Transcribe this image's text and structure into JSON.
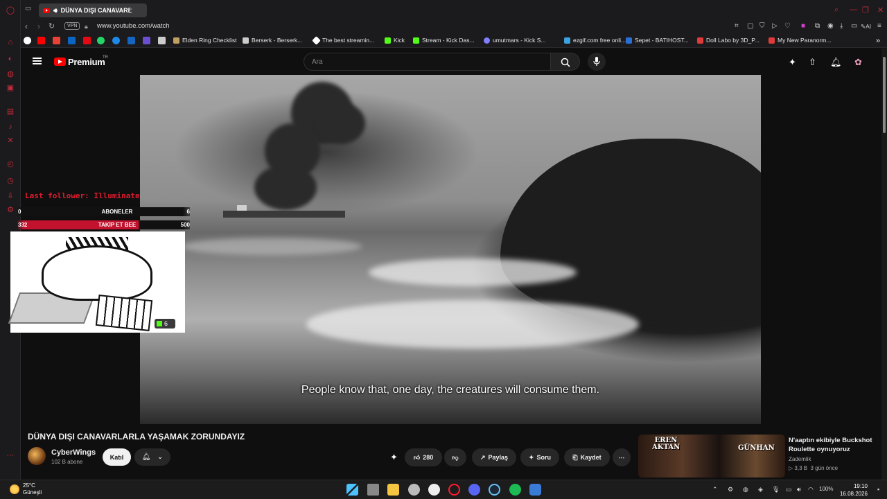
{
  "browser": {
    "tab_title": "DÜNYA DIŞI CANAVARL",
    "url": "www.youtube.com/watch",
    "vpn_label": "VPN",
    "ai_label": "AI",
    "bookmarks": [
      {
        "label": "Elden Ring Checklist",
        "color": "#c0a060"
      },
      {
        "label": "Berserk - Berserk...",
        "color": "#cccccc"
      },
      {
        "label": "The best streamin...",
        "color": "#ffffff"
      },
      {
        "label": "Kick",
        "color": "#53fc18"
      },
      {
        "label": "Stream - Kick Das...",
        "color": "#53fc18"
      },
      {
        "label": "umutmars - Kick S...",
        "color": "#7f7fff"
      },
      {
        "label": "ezgif.com free onli...",
        "color": "#3aa3e0"
      },
      {
        "label": "Sepet - BATIHOST...",
        "color": "#2a6fd6"
      },
      {
        "label": "Doll Labo by 3D_P...",
        "color": "#e03a3a"
      },
      {
        "label": "My New Paranorm...",
        "color": "#e03a3a"
      }
    ]
  },
  "youtube": {
    "logo_text": "Premium",
    "logo_country": "TR",
    "search_placeholder": "Ara"
  },
  "player": {
    "subtitle": "People know that, one day, the creatures will consume them."
  },
  "overlay": {
    "last_follower": "Last follower: Illuminate",
    "rows": [
      {
        "left": "0",
        "label": "ABONELER",
        "right": "6"
      },
      {
        "left": "332",
        "label": "TAKİP ET BEE",
        "right": "500"
      }
    ],
    "kick_count": "6"
  },
  "video": {
    "title": "DÜNYA DIŞI CANAVARLARLA YAŞAMAK ZORUNDAYIZ",
    "channel": "CyberWings",
    "subscribers": "102 B abone",
    "join_label": "Katıl",
    "like_count": "280",
    "share_label": "Paylaş",
    "ask_label": "Soru",
    "save_label": "Kaydet"
  },
  "recommendation": {
    "thumb_left_text": "EREN AKTAN",
    "thumb_right_text": "GÜNHAN",
    "title": "N'aaptın ekibiyle Buckshot Roulette oynuyoruz",
    "channel": "Zademlik",
    "views": "3,3 B",
    "age": "3 gün önce"
  },
  "taskbar": {
    "temperature": "25°C",
    "weather": "Güneşli",
    "battery": "100%",
    "time": "19:10",
    "date": "16.08.2026"
  }
}
